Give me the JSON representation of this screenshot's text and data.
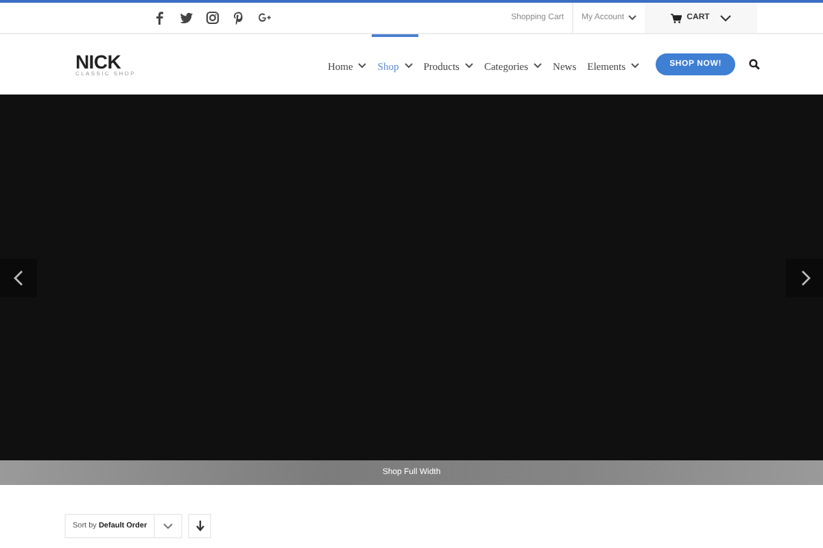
{
  "top_bar": {
    "social": [
      {
        "kind": "facebook"
      },
      {
        "kind": "twitter"
      },
      {
        "kind": "instagram"
      },
      {
        "kind": "pinterest"
      },
      {
        "kind": "google-plus"
      }
    ],
    "links": [
      {
        "label": "Shopping Cart",
        "has_caret": false
      },
      {
        "label": "My Account",
        "has_caret": true
      }
    ],
    "cart": {
      "label": "CART"
    }
  },
  "logo": {
    "name": "NICK",
    "tagline": "CLASSIC SHOP"
  },
  "nav": [
    {
      "label": "Home",
      "selected": false,
      "has_caret": true
    },
    {
      "label": "Shop",
      "selected": true,
      "has_caret": true
    },
    {
      "label": "Products",
      "selected": false,
      "has_caret": true
    },
    {
      "label": "Categories",
      "selected": false,
      "has_caret": true
    },
    {
      "label": "News",
      "selected": false,
      "has_caret": false
    },
    {
      "label": "Elements",
      "selected": false,
      "has_caret": true
    }
  ],
  "cta": {
    "label": "SHOP NOW!"
  },
  "page_title_bar": {
    "title": "Shop Full Width"
  },
  "sort": {
    "prefix": "Sort by",
    "value": "Default Order"
  }
}
